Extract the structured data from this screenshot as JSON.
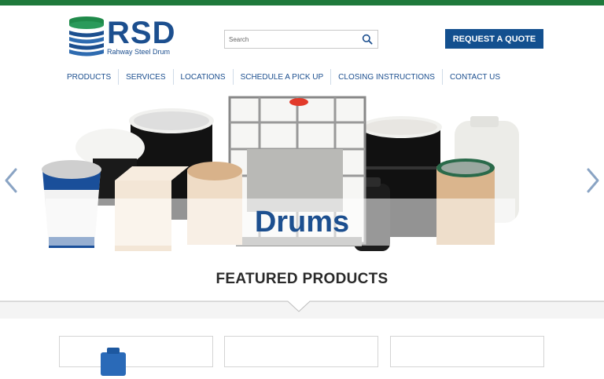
{
  "brand": {
    "name": "RSD",
    "tagline": "Rahway Steel Drum",
    "colors": {
      "primary": "#13508f",
      "topbar": "#1f7a3c",
      "logo_green": "#1f8a4a"
    }
  },
  "search": {
    "placeholder": "Search",
    "value": "",
    "icon": "search-icon"
  },
  "cta": {
    "label": "REQUEST A QUOTE"
  },
  "nav": {
    "items": [
      {
        "label": "PRODUCTS"
      },
      {
        "label": "SERVICES"
      },
      {
        "label": "LOCATIONS"
      },
      {
        "label": "SCHEDULE A PICK UP"
      },
      {
        "label": "CLOSING INSTRUCTIONS"
      },
      {
        "label": "CONTACT US"
      }
    ]
  },
  "hero": {
    "caption": "Drums",
    "prev_icon": "chevron-left-icon",
    "next_icon": "chevron-right-icon"
  },
  "featured": {
    "title": "FEATURED PRODUCTS"
  }
}
